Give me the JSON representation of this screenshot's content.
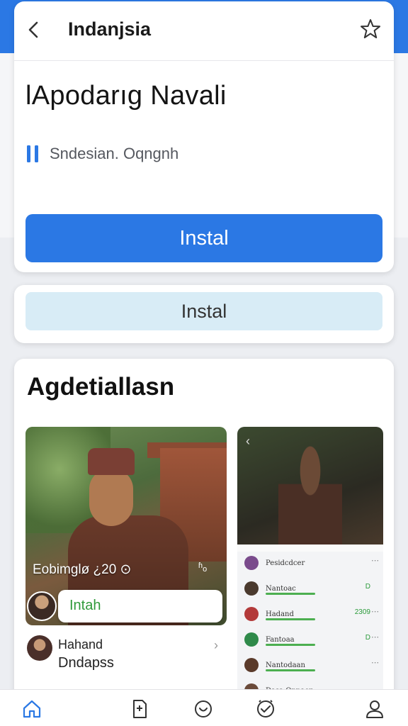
{
  "header": {
    "title": "Indanjsia"
  },
  "app": {
    "name": "lApodarıg Navali",
    "developer": "Sndesian. Oqngnh",
    "install_label": "Instal"
  },
  "secondary": {
    "install_label": "Instal"
  },
  "gallery": {
    "title": "Agdetiallasn",
    "left_shot": {
      "caption": "Eobimglø ¿20 ⊙",
      "caption_icon": "ʱₒ",
      "pill_label": "Intah"
    },
    "right_shot": {
      "rows": [
        {
          "name": "Pesidcdcer",
          "trail": "",
          "avatar": "#7a4b8c"
        },
        {
          "name": "Nantoac",
          "trail": "D",
          "avatar": "#4a3a2e"
        },
        {
          "name": "Hadand",
          "trail": "2309",
          "avatar": "#b33a3a"
        },
        {
          "name": "Fantoaa",
          "trail": "D",
          "avatar": "#2f8a4a"
        },
        {
          "name": "Nantodaan",
          "trail": "",
          "avatar": "#5a3a2a"
        },
        {
          "name": "Dasa Onnaer",
          "trail": "",
          "avatar": "#6a4a3a"
        }
      ]
    },
    "author": {
      "name": "Hahand",
      "sub": "Dndapss"
    }
  },
  "nav": {
    "items": [
      "home-icon",
      "file-icon",
      "smile-icon",
      "check-circle-icon",
      "profile-icon"
    ]
  },
  "colors": {
    "accent": "#2b78e4",
    "secondary_button": "#d8ecf6",
    "success": "#2f9a3a"
  }
}
